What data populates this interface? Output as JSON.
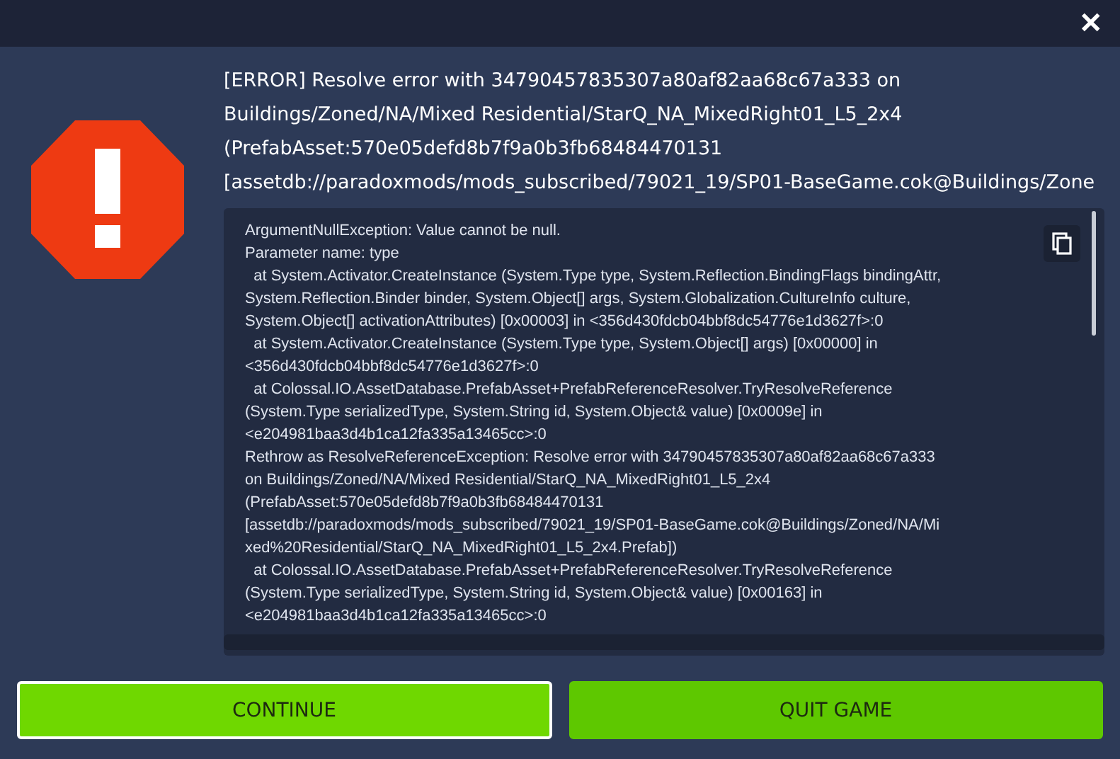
{
  "close_button": {
    "label": "✕"
  },
  "message": {
    "lines": [
      "[ERROR] Resolve error with 34790457835307a80af82aa68c67a333 on",
      "Buildings/Zoned/NA/Mixed Residential/StarQ_NA_MixedRight01_L5_2x4",
      "(PrefabAsset:570e05defd8b7f9a0b3fb68484470131",
      "[assetdb://paradoxmods/mods_subscribed/79021_19/SP01-BaseGame.cok@Buildings/Zone"
    ]
  },
  "details": {
    "lines": [
      "ArgumentNullException: Value cannot be null.",
      "Parameter name: type",
      "  at System.Activator.CreateInstance (System.Type type, System.Reflection.BindingFlags bindingAttr,",
      "System.Reflection.Binder binder, System.Object[] args, System.Globalization.CultureInfo culture,",
      "System.Object[] activationAttributes) [0x00003] in <356d430fdcb04bbf8dc54776e1d3627f>:0",
      "  at System.Activator.CreateInstance (System.Type type, System.Object[] args) [0x00000] in",
      "<356d430fdcb04bbf8dc54776e1d3627f>:0",
      "  at Colossal.IO.AssetDatabase.PrefabAsset+PrefabReferenceResolver.TryResolveReference",
      "(System.Type serializedType, System.String id, System.Object& value) [0x0009e] in",
      "<e204981baa3d4b1ca12fa335a13465cc>:0",
      "Rethrow as ResolveReferenceException: Resolve error with 34790457835307a80af82aa68c67a333",
      "on Buildings/Zoned/NA/Mixed Residential/StarQ_NA_MixedRight01_L5_2x4",
      "(PrefabAsset:570e05defd8b7f9a0b3fb68484470131",
      "[assetdb://paradoxmods/mods_subscribed/79021_19/SP01-BaseGame.cok@Buildings/Zoned/NA/Mi",
      "xed%20Residential/StarQ_NA_MixedRight01_L5_2x4.Prefab])",
      "  at Colossal.IO.AssetDatabase.PrefabAsset+PrefabReferenceResolver.TryResolveReference",
      "(System.Type serializedType, System.String id, System.Object& value) [0x00163] in",
      "<e204981baa3d4b1ca12fa335a13465cc>:0"
    ]
  },
  "buttons": [
    {
      "label": "CONTINUE",
      "selected": true
    },
    {
      "label": "QUIT GAME",
      "selected": false
    }
  ]
}
